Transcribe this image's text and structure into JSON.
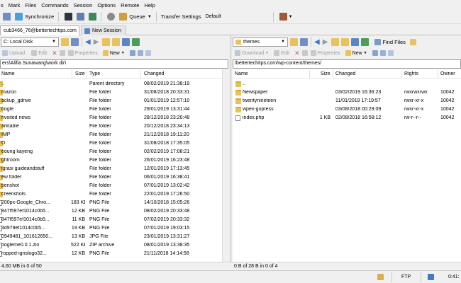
{
  "menu": [
    "s",
    "Mark",
    "Files",
    "Commands",
    "Session",
    "Options",
    "Remote",
    "Help"
  ],
  "toolbar": {
    "synchronize": "Synchronize",
    "queue": "Queue",
    "transfer_settings_label": "Transfer Settings",
    "transfer_settings_value": "Default"
  },
  "tabs": {
    "session": "cub3466_76@bettertechtips.com",
    "new_session": "New Session"
  },
  "left": {
    "drive": "C: Local Disk",
    "upload": "Upload",
    "edit": "Edit",
    "properties": "Properties",
    "new": "New",
    "path": "ers\\Alifia Sunawang\\work dir\\",
    "columns": [
      "Name",
      "Size",
      "Type",
      "Changed"
    ],
    "rows": [
      {
        "name": "..",
        "size": "",
        "type": "Parent directory",
        "changed": "08/02/2019  21:38:19",
        "icon": "up"
      },
      {
        "name": "mazon",
        "size": "",
        "type": "File folder",
        "changed": "31/08/2018  20:33:31",
        "icon": "folder"
      },
      {
        "name": "ackup_gdrive",
        "size": "",
        "type": "File folder",
        "changed": "01/01/2019  12:57:10",
        "icon": "folder"
      },
      {
        "name": "oogle",
        "size": "",
        "type": "File folder",
        "changed": "29/01/2019  13:31:44",
        "icon": "folder"
      },
      {
        "name": "nvoited news",
        "size": "",
        "type": "File folder",
        "changed": "28/12/2018  23:20:48",
        "icon": "folder"
      },
      {
        "name": "arktable",
        "size": "",
        "type": "File folder",
        "changed": "20/12/2018  23:34:13",
        "icon": "folder"
      },
      {
        "name": "IMP",
        "size": "",
        "type": "File folder",
        "changed": "21/12/2018  19:11:20",
        "icon": "folder"
      },
      {
        "name": "O",
        "size": "",
        "type": "File folder",
        "changed": "31/08/2018  17:35:05",
        "icon": "folder"
      },
      {
        "name": "eoung kayeng",
        "size": "",
        "type": "File folder",
        "changed": "02/02/2019  17:08:21",
        "icon": "folder"
      },
      {
        "name": "ghtroom",
        "size": "",
        "type": "File folder",
        "changed": "26/01/2019  16:23:48",
        "icon": "folder"
      },
      {
        "name": "igrasi guideandstuff",
        "size": "",
        "type": "File folder",
        "changed": "12/01/2019  17:13:45",
        "icon": "folder"
      },
      {
        "name": "ew folder",
        "size": "",
        "type": "File folder",
        "changed": "06/01/2019  16:38:41",
        "icon": "folder"
      },
      {
        "name": "penshot",
        "size": "",
        "type": "File folder",
        "changed": "07/01/2019  13:02:42",
        "icon": "folder"
      },
      {
        "name": "creenshots",
        "size": "",
        "type": "File folder",
        "changed": "22/01/2019  17:26:50",
        "icon": "folder"
      },
      {
        "name": "200px-Google_Chro...",
        "size": "183 KB",
        "type": "PNG File",
        "changed": "14/10/2018  15:05:26",
        "icon": "file"
      },
      {
        "name": "847f597ef1014c0b5...",
        "size": "12 KB",
        "type": "PNG File",
        "changed": "08/02/2019  20:33:48",
        "icon": "file"
      },
      {
        "name": "847f597ef1014c0b5...",
        "size": "11 KB",
        "type": "PNG File",
        "changed": "07/02/2019  20:33:32",
        "icon": "file"
      },
      {
        "name": "3d979ef1014c0b5...",
        "size": "19 KB",
        "type": "PNG File",
        "changed": "07/01/2019  19:03:15",
        "icon": "file"
      },
      {
        "name": "0949481_101612650...",
        "size": "13 KB",
        "type": "JPG File",
        "changed": "23/01/2019  13:31:27",
        "icon": "file"
      },
      {
        "name": "oogleme0.0.1.zio",
        "size": "522 KB",
        "type": "ZIP archive",
        "changed": "08/01/2019  13:38:35",
        "icon": "file"
      },
      {
        "name": "ropped-ignslogo32...",
        "size": "12 KB",
        "type": "PNG File",
        "changed": "21/11/2018  14:14:58",
        "icon": "file"
      }
    ],
    "status": "4,60 MB in 0 of 50"
  },
  "right": {
    "drive": "themes",
    "find_files": "Find Files",
    "download": "Download",
    "edit": "Edit",
    "properties": "Properties",
    "new": "New",
    "path": "/bettertechtips.com/wp-content/themes/",
    "columns": [
      "Name",
      "Size",
      "Changed",
      "Rights",
      "Owner"
    ],
    "rows": [
      {
        "name": "..",
        "size": "",
        "changed": "",
        "rights": "",
        "owner": "",
        "icon": "up"
      },
      {
        "name": "Newspaper",
        "size": "",
        "changed": "03/02/2019  16:36:23",
        "rights": "rwxrwxrwx",
        "owner": "10042",
        "icon": "folder"
      },
      {
        "name": "twentynineteen",
        "size": "",
        "changed": "11/01/2019  17:19:57",
        "rights": "rwxr-xr-x",
        "owner": "10042",
        "icon": "folder"
      },
      {
        "name": "wpex-gopress",
        "size": "",
        "changed": "03/08/2018  00:29:09",
        "rights": "rwxr-xr-x",
        "owner": "10042",
        "icon": "folder"
      },
      {
        "name": "index.php",
        "size": "1 KB",
        "changed": "02/08/2018  16:58:12",
        "rights": "rw-r--r--",
        "owner": "10042",
        "icon": "file"
      }
    ],
    "status": "0 B of 28 B in 0 of 4"
  },
  "statusbar": {
    "protocol": "FTP",
    "time": "0:41:"
  },
  "colors": {
    "folder": "#e8c25a",
    "accent": "#3a78c9",
    "window_bg": "#f0f0f0"
  }
}
